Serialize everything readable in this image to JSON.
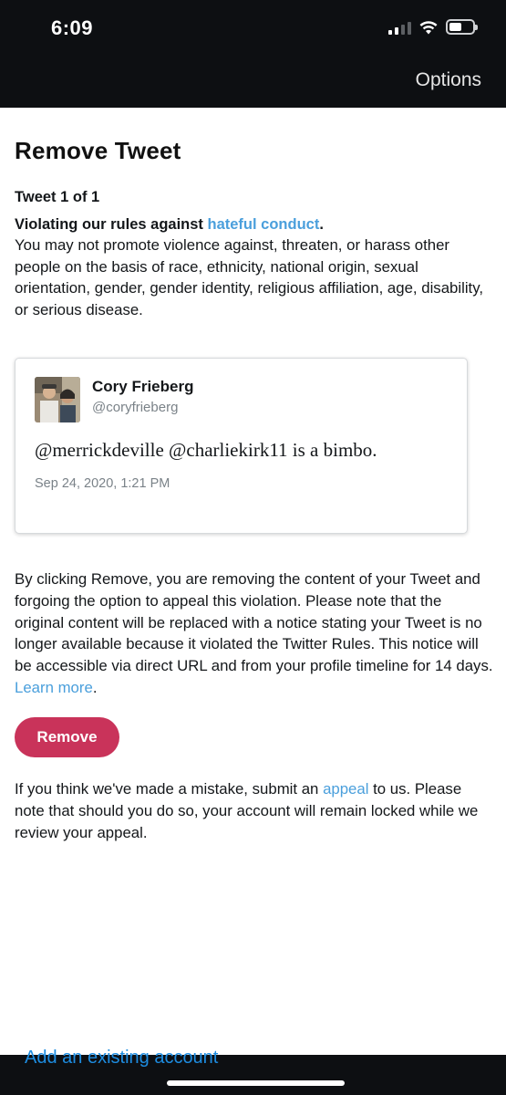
{
  "status_bar": {
    "time": "6:09"
  },
  "header": {
    "options_label": "Options"
  },
  "page": {
    "title": "Remove Tweet",
    "tweet_count": "Tweet 1 of 1",
    "rule_prefix": "Violating our rules against ",
    "rule_link": "hateful conduct",
    "rule_suffix": ".",
    "rule_description": "You may not promote violence against, threaten, or harass other people on the basis of race, ethnicity, national origin, sexual orientation, gender, gender identity, religious affiliation, age, disability, or serious disease."
  },
  "tweet": {
    "author_name": "Cory Frieberg",
    "author_handle": "@coryfrieberg",
    "text": "@merrickdeville @charliekirk11 is a bimbo.",
    "date": "Sep 24, 2020, 1:21 PM"
  },
  "notice": {
    "text": "By clicking Remove, you are removing the content of your Tweet and forgoing the option to appeal this violation. Please note that the original content will be replaced with a notice stating your Tweet is no longer available because it violated the Twitter Rules. This notice will be accessible via direct URL and from your profile timeline for 14 days. ",
    "learn_more": "Learn more",
    "end": "."
  },
  "actions": {
    "remove_label": "Remove"
  },
  "appeal": {
    "prefix": "If you think we've made a mistake, submit an ",
    "link": "appeal",
    "suffix": " to us. Please note that should you do so, your account will remain locked while we review your appeal."
  },
  "footer": {
    "add_account": "Add an existing account"
  },
  "colors": {
    "accent": "#4a9fdc",
    "remove_button": "#c9335a",
    "dark_bar": "#0d0f12"
  }
}
